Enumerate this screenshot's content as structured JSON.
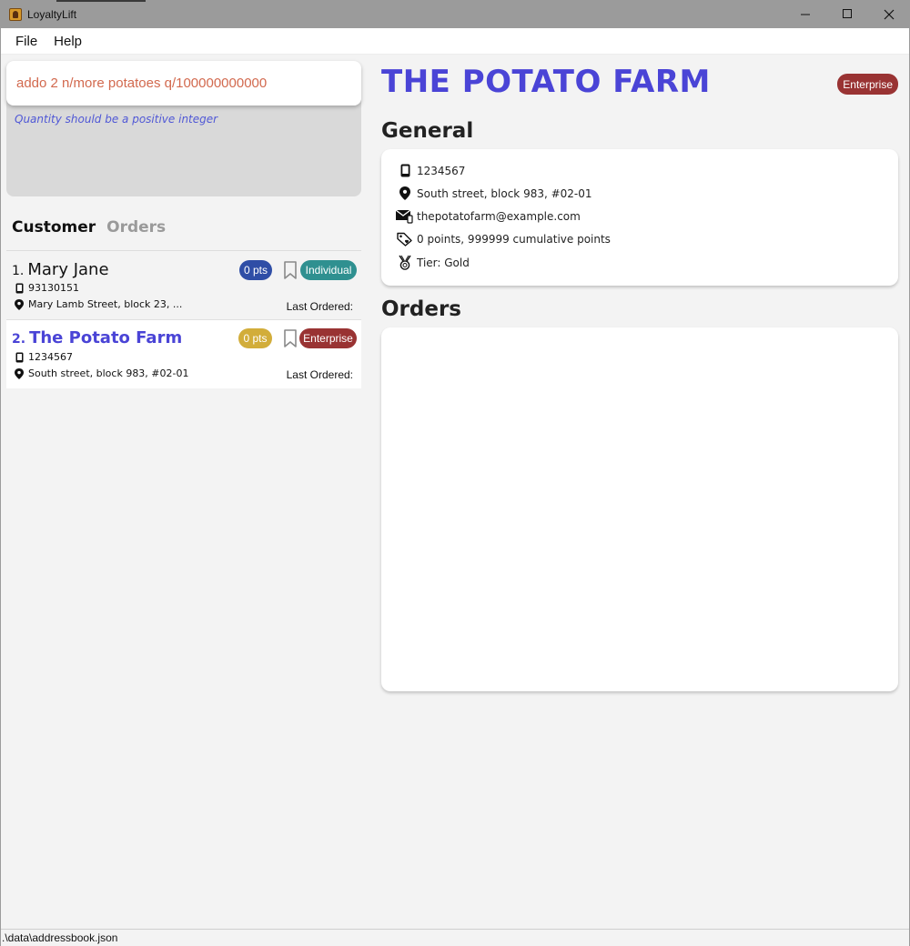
{
  "window": {
    "title": "LoyaltyLift",
    "controls": {
      "minimize": "─",
      "maximize": "☐",
      "close": "✕"
    }
  },
  "menu": {
    "file": "File",
    "help": "Help"
  },
  "command": {
    "value": "addo 2 n/more potatoes q/100000000000",
    "result": "Quantity should be a positive integer"
  },
  "tabs": {
    "customer": "Customer",
    "orders": "Orders"
  },
  "customers": [
    {
      "index": "1.",
      "name": "Mary Jane",
      "points": "0 pts",
      "points_color": "#2f4ea6",
      "phone": "93130151",
      "address": "Mary Lamb Street, block 23, ...",
      "type": "Individual",
      "type_color": "#2f9090",
      "last_ordered": "Last Ordered:"
    },
    {
      "index": "2.",
      "name": "The Potato Farm",
      "points": "0 pts",
      "points_color": "#d2ad3a",
      "phone": "1234567",
      "address": "South street, block 983, #02-01",
      "type": "Enterprise",
      "type_color": "#993333",
      "last_ordered": "Last Ordered:"
    }
  ],
  "detail": {
    "title": "THE POTATO FARM",
    "badge": "Enterprise",
    "general_heading": "General",
    "phone": "1234567",
    "address": "South street, block 983, #02-01",
    "email": "thepotatofarm@example.com",
    "points": "0 points, 999999 cumulative points",
    "tier": "Tier: Gold",
    "orders_heading": "Orders"
  },
  "status": {
    "path": ".\\data\\addressbook.json"
  },
  "colors": {
    "accent": "#4a44d6",
    "error_text": "#d2694e",
    "result_text": "#5058d6"
  },
  "icons": {
    "phone": "phone-icon",
    "address": "location-pin-icon",
    "email": "email-icon",
    "points": "tag-icon",
    "tier": "medal-icon",
    "bookmark": "bookmark-icon"
  }
}
